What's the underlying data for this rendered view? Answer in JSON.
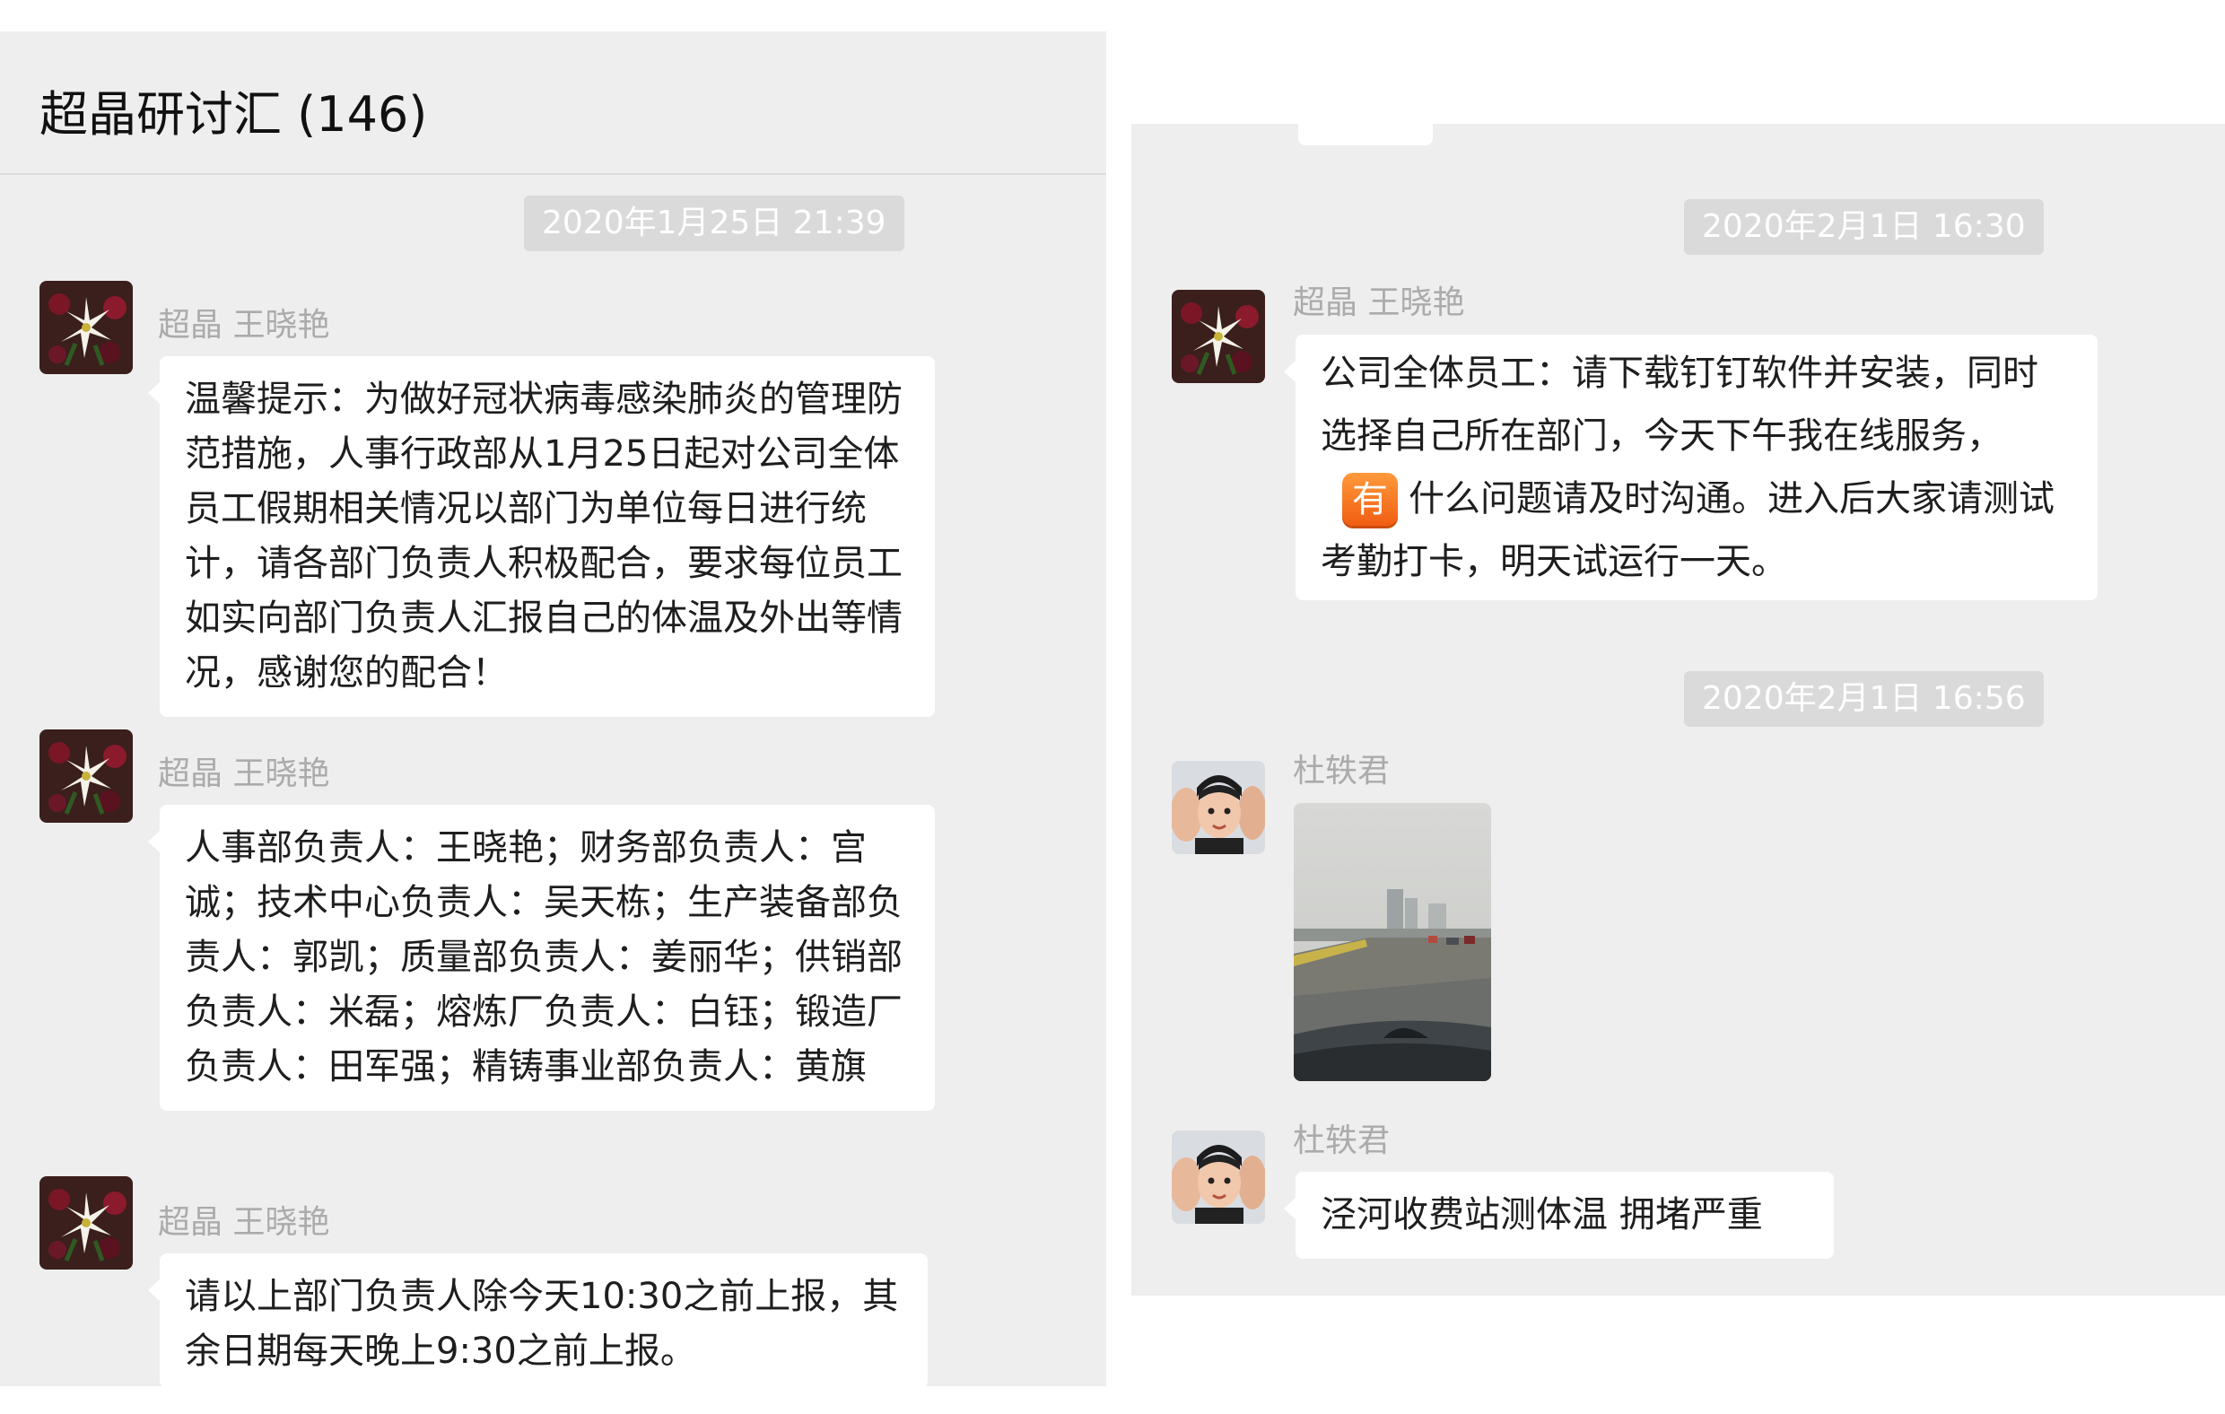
{
  "left_window": {
    "title": "超晶研讨汇 (146)",
    "timestamp": "2020年1月25日 21:39",
    "messages": [
      {
        "sender": "超晶 王晓艳",
        "text": "温馨提示：为做好冠状病毒感染肺炎的管理防范措施，人事行政部从1月25日起对公司全体员工假期相关情况以部门为单位每日进行统计，请各部门负责人积极配合，要求每位员工如实向部门负责人汇报自己的体温及外出等情况，感谢您的配合！"
      },
      {
        "sender": "超晶 王晓艳",
        "text": "人事部负责人：王晓艳；财务部负责人：宫诚；技术中心负责人：吴天栋；生产装备部负责人：郭凯；质量部负责人：姜丽华；供销部负责人：米磊；熔炼厂负责人：白钰；锻造厂负责人：田军强；精铸事业部负责人：黄旗"
      },
      {
        "sender": "超晶 王晓艳",
        "text": " 请以上部门负责人除今天10:30之前上报，其余日期每天晚上9:30之前上报。"
      }
    ]
  },
  "right_window": {
    "timestamp_1": "2020年2月1日 16:30",
    "message_1": {
      "sender": "超晶 王晓艳",
      "text_before_emoji": "公司全体员工：请下载钉钉软件并安装，同时选择自己所在部门，今天下午我在线服务，",
      "emoji_char": "有",
      "text_after_emoji": "什么问题请及时沟通。进入后大家请测试考勤打卡，明天试运行一天。"
    },
    "timestamp_2": "2020年2月1日 16:56",
    "message_2": {
      "sender": "杜轶君"
    },
    "message_3": {
      "sender": "杜轶君",
      "text": "泾河收费站测体温 拥堵严重"
    }
  },
  "icons": {
    "sender_avatar_1": "flower-bouquet-avatar-icon",
    "sender_avatar_2": "child-photo-avatar-icon",
    "emoji": "you-emoji-icon",
    "photo": "road-photo-image"
  },
  "colors": {
    "panel_background": "#eeeeee",
    "bubble_background": "#ffffff",
    "timestamp_background": "#dadada",
    "sender_name": "#ababab"
  }
}
